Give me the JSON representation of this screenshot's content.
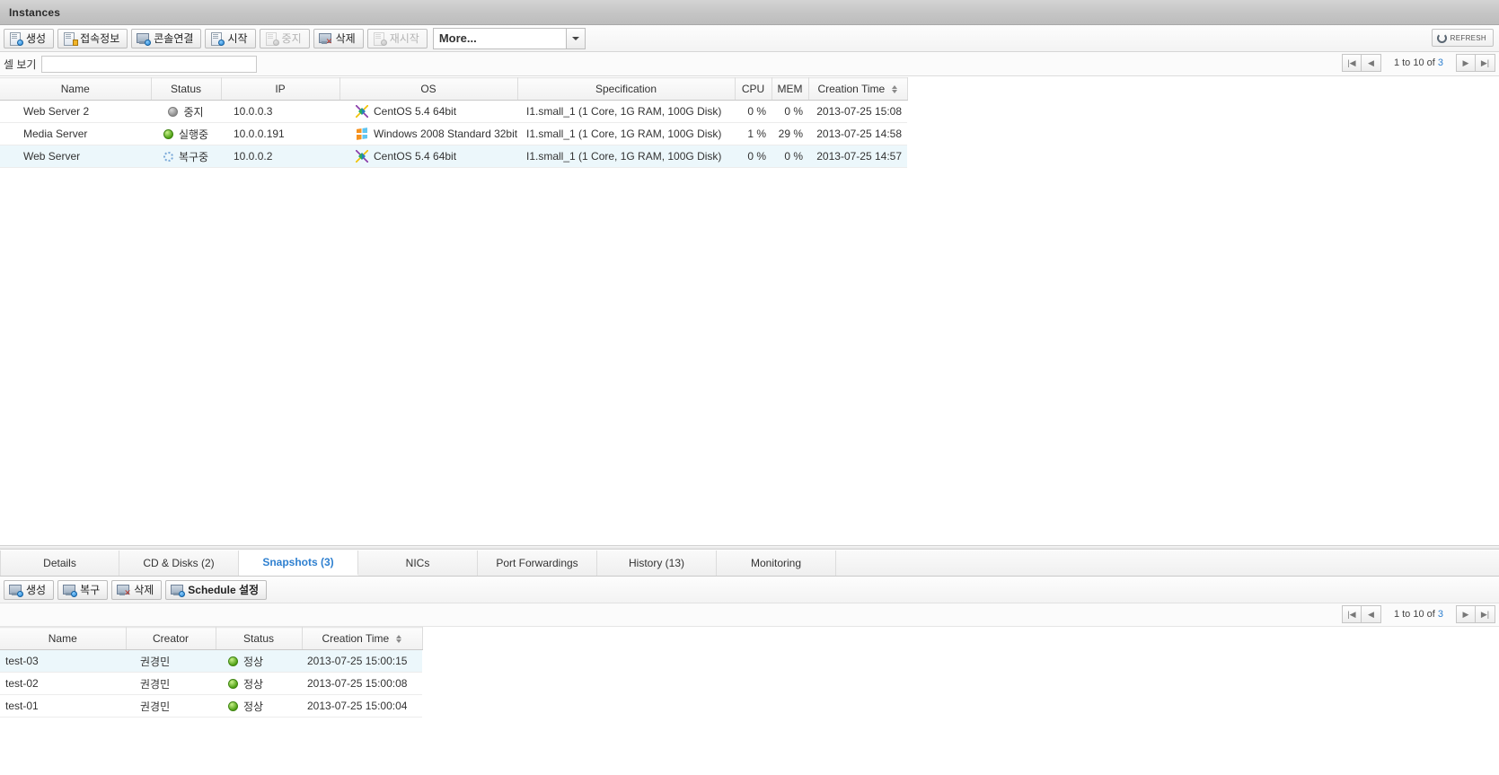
{
  "window": {
    "title": "Instances"
  },
  "toolbar": {
    "buttons": [
      {
        "label": "생성",
        "icon": "create-icon",
        "disabled": false
      },
      {
        "label": "접속정보",
        "icon": "connection-info-icon",
        "disabled": false
      },
      {
        "label": "콘솔연결",
        "icon": "console-connect-icon",
        "disabled": false
      },
      {
        "label": "시작",
        "icon": "start-icon",
        "disabled": false
      },
      {
        "label": "중지",
        "icon": "stop-icon",
        "disabled": true
      },
      {
        "label": "삭제",
        "icon": "delete-icon",
        "disabled": false
      },
      {
        "label": "재시작",
        "icon": "restart-icon",
        "disabled": true
      }
    ],
    "more_label": "More...",
    "refresh_label": "REFRESH",
    "refresh_icon": "refresh-icon"
  },
  "filter": {
    "label": "셀 보기",
    "value": "",
    "placeholder": ""
  },
  "pager_top": {
    "first": "|◀",
    "prev": "◀",
    "text_prefix": "1 to 10 of",
    "total": "3",
    "next": "▶",
    "last": "▶|"
  },
  "instances_grid": {
    "columns": [
      {
        "label": "Name",
        "sortable": false
      },
      {
        "label": "Status",
        "sortable": false
      },
      {
        "label": "IP",
        "sortable": false
      },
      {
        "label": "OS",
        "sortable": false
      },
      {
        "label": "Specification",
        "sortable": false
      },
      {
        "label": "CPU",
        "sortable": false
      },
      {
        "label": "MEM",
        "sortable": false
      },
      {
        "label": "Creation Time",
        "sortable": true
      }
    ],
    "rows": [
      {
        "name": "Web Server 2",
        "status": "중지",
        "status_kind": "stopped",
        "ip": "10.0.0.3",
        "os": "CentOS 5.4 64bit",
        "os_icon": "centos-icon",
        "spec": "I1.small_1 (1 Core, 1G RAM, 100G Disk)",
        "cpu": "0 %",
        "mem": "0 %",
        "created": "2013-07-25 15:08",
        "selected": false
      },
      {
        "name": "Media Server",
        "status": "실행중",
        "status_kind": "running",
        "ip": "10.0.0.191",
        "os": "Windows 2008 Standard 32bit",
        "os_icon": "windows-icon",
        "spec": "I1.small_1 (1 Core, 1G RAM, 100G Disk)",
        "cpu": "1 %",
        "mem": "29 %",
        "created": "2013-07-25 14:58",
        "selected": false
      },
      {
        "name": "Web Server",
        "status": "복구중",
        "status_kind": "recovering",
        "ip": "10.0.0.2",
        "os": "CentOS 5.4 64bit",
        "os_icon": "centos-icon",
        "spec": "I1.small_1 (1 Core, 1G RAM, 100G Disk)",
        "cpu": "0 %",
        "mem": "0 %",
        "created": "2013-07-25 14:57",
        "selected": true
      }
    ]
  },
  "detail_tabs": [
    {
      "label": "Details",
      "active": false
    },
    {
      "label": "CD & Disks (2)",
      "active": false
    },
    {
      "label": "Snapshots (3)",
      "active": true
    },
    {
      "label": "NICs",
      "active": false
    },
    {
      "label": "Port Forwardings",
      "active": false
    },
    {
      "label": "History (13)",
      "active": false
    },
    {
      "label": "Monitoring",
      "active": false
    }
  ],
  "snapshot_toolbar": {
    "buttons": [
      {
        "label": "생성",
        "icon": "create-icon",
        "bold": false
      },
      {
        "label": "복구",
        "icon": "restore-icon",
        "bold": false
      },
      {
        "label": "삭제",
        "icon": "delete-icon",
        "bold": false
      },
      {
        "label": "Schedule 설정",
        "icon": "schedule-icon",
        "bold": true
      }
    ]
  },
  "pager_bottom": {
    "first": "|◀",
    "prev": "◀",
    "text_prefix": "1 to 10 of",
    "total": "3",
    "next": "▶",
    "last": "▶|"
  },
  "snapshots_grid": {
    "columns": [
      {
        "label": "Name",
        "sortable": false
      },
      {
        "label": "Creator",
        "sortable": false
      },
      {
        "label": "Status",
        "sortable": false
      },
      {
        "label": "Creation Time",
        "sortable": true
      }
    ],
    "rows": [
      {
        "name": "test-03",
        "creator": "권경민",
        "status": "정상",
        "created": "2013-07-25 15:00:15",
        "selected": true
      },
      {
        "name": "test-02",
        "creator": "권경민",
        "status": "정상",
        "created": "2013-07-25 15:00:08",
        "selected": false
      },
      {
        "name": "test-01",
        "creator": "권경민",
        "status": "정상",
        "created": "2013-07-25 15:00:04",
        "selected": false
      }
    ]
  },
  "colors": {
    "accent_blue": "#2f80d0",
    "value_orange": "#e08a2e",
    "status_green": "#4da012",
    "status_gray": "#8e8e8e",
    "selection_bg": "#ecf7fb"
  }
}
